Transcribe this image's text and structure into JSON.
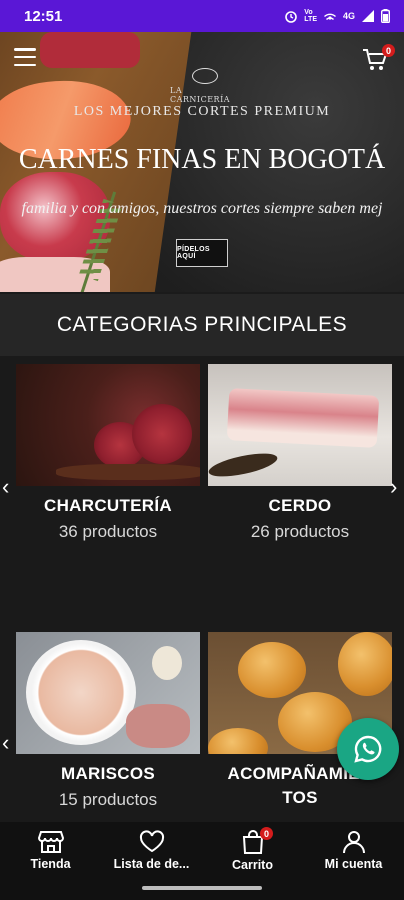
{
  "status_bar": {
    "time": "12:51",
    "network": "4G",
    "volte": "Vo\nLTE"
  },
  "header": {
    "cart_count": "0"
  },
  "hero": {
    "logo_text": "LA CARNICERÍA",
    "tagline": "LOS MEJORES CORTES PREMIUM",
    "title": "CARNES FINAS EN BOGOTÁ",
    "subtitle": "familia y con amigos, nuestros cortes siempre saben mej",
    "button_label": "PÍDELOS AQUÍ"
  },
  "section_title": "CATEGORIAS PRINCIPALES",
  "categories": [
    {
      "name": "CHARCUTERÍA",
      "count": "36 productos"
    },
    {
      "name": "CERDO",
      "count": "26 productos"
    },
    {
      "name": "MARISCOS",
      "count": "15 productos"
    },
    {
      "name": "ACOMPAÑAMIEN\nTOS",
      "count": ""
    }
  ],
  "bottom_nav": [
    {
      "label": "Tienda",
      "icon": "store-icon"
    },
    {
      "label": "Lista de de...",
      "icon": "heart-icon"
    },
    {
      "label": "Carrito",
      "icon": "bag-icon",
      "badge": "0"
    },
    {
      "label": "Mi cuenta",
      "icon": "user-icon"
    }
  ],
  "colors": {
    "status_bar": "#5a17d6",
    "whatsapp": "#1aa684",
    "badge": "#d41c1c"
  }
}
